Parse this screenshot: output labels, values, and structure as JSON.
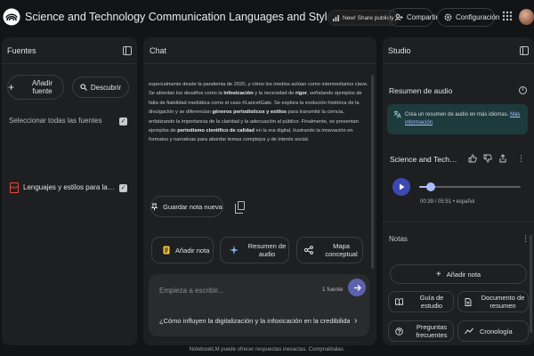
{
  "app": {
    "title": "Science and Technology Communication Languages and Styles"
  },
  "header": {
    "new_label": "New! Share publicly",
    "share_label": "Compartir",
    "settings_label": "Configuración"
  },
  "sources": {
    "title": "Fuentes",
    "add_label": "Añadir fuente",
    "discover_label": "Descubrir",
    "select_all_label": "Seleccionar todas las fuentes",
    "item_label": "Lenguajes y estilos para la comuni...",
    "item_type": "PDF"
  },
  "chat": {
    "title": "Chat",
    "segments": [
      {
        "t": "especialmente desde la pandemia de 2020, y cómo los medios actúan como intermediarios clave. Se abordan los desafíos como la ",
        "b": false
      },
      {
        "t": "infoxicación",
        "b": true
      },
      {
        "t": " y la necesidad de ",
        "b": false
      },
      {
        "t": "rigor",
        "b": true
      },
      {
        "t": ", señalando ejemplos de falta de fiabilidad mediática como el caso #LancetGate. Se explora la evolución histórica de la divulgación y se diferencian ",
        "b": false
      },
      {
        "t": "géneros periodísticos y estilos",
        "b": true
      },
      {
        "t": " para transmitir la ciencia, enfatizando la importancia de la claridad y la adecuación al público. Finalmente, se presentan ejemplos de ",
        "b": false
      },
      {
        "t": "periodismo científico de calidad",
        "b": true
      },
      {
        "t": " en la era digital, ilustrando la innovación en formatos y narrativas para abordar temas complejos y de interés social.",
        "b": false
      }
    ],
    "save_note_label": "Guardar nota nueva",
    "actions": {
      "add_note": "Añadir nota",
      "audio_summary": "Resumen de audio",
      "concept_map": "Mapa conceptual"
    },
    "composer_placeholder": "Empieza a escribir...",
    "source_count": "1 fuente",
    "suggestion": "¿Cómo influyen la digitalización y la infoxicación en la credibilidad de la ciencia?"
  },
  "studio": {
    "title": "Studio",
    "audio_section_title": "Resumen de audio",
    "banner_text": "Crea un resumen de audio en más idiomas.",
    "banner_link": "Más información",
    "audio_title": "Science and Technology Communication",
    "audio_time": "00:39 / 05:51 • español",
    "audio_progress": 0.11,
    "notes_title": "Notas",
    "add_note_label": "Añadir nota",
    "buttons": {
      "study_guide": "Guía de estudio",
      "briefing_doc": "Documento de resumen",
      "faq": "Preguntas frecuentes",
      "timeline": "Cronología"
    }
  },
  "footer": {
    "disclaimer": "NotebookLM puede ofrecer respuestas inexactas. Compruébalas."
  },
  "colors": {
    "accent": "#a9bdfb",
    "play": "#3b49b0",
    "send": "#5b63ad",
    "banner": "#1d3b3d",
    "pdf": "#e64a44"
  }
}
